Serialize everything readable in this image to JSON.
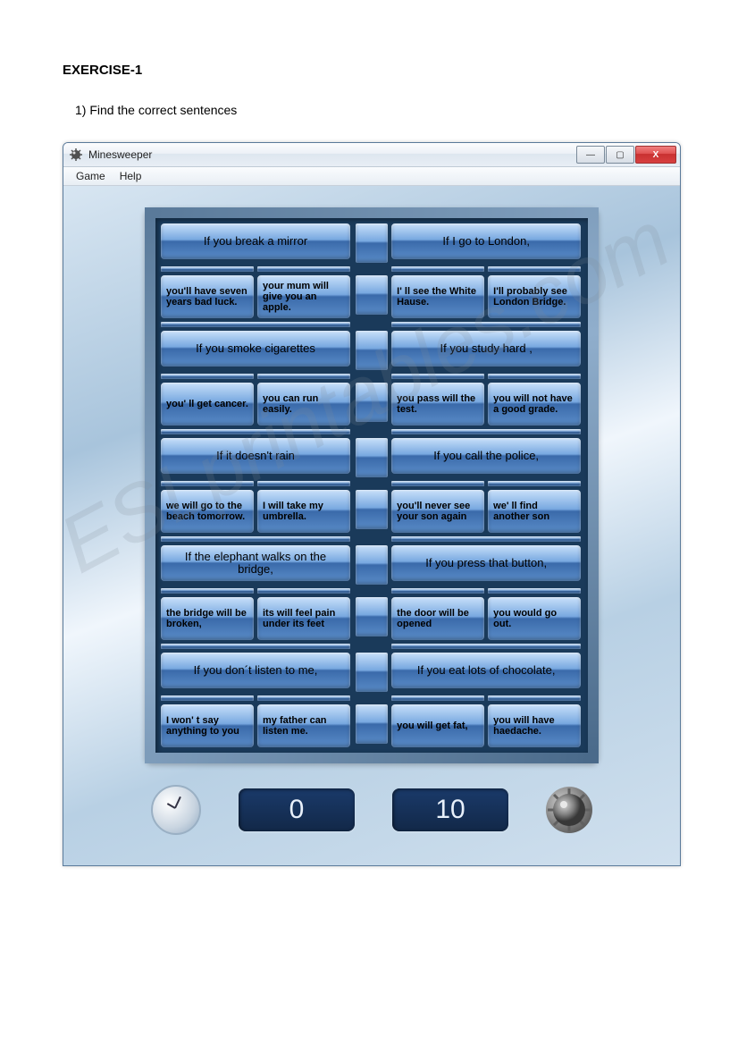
{
  "exercise": {
    "title": "EXERCISE-1",
    "instruction": "1)  Find the correct sentences"
  },
  "window": {
    "title": "Minesweeper",
    "menu": {
      "game": "Game",
      "help": "Help"
    },
    "win_buttons": {
      "min": "—",
      "max": "▢",
      "close": "X"
    }
  },
  "board": {
    "left": [
      {
        "cond": "If you break a mirror",
        "a": "you'll have seven years bad luck.",
        "b": "your mum will give you an apple."
      },
      {
        "cond": "If you smoke cigarettes",
        "a": "you' ll get cancer.",
        "b": "you can run easily."
      },
      {
        "cond": "If it doesn't rain",
        "a": "we will go to the beach tomorrow.",
        "b": "I will take my umbrella."
      },
      {
        "cond": "If the elephant walks on the bridge,",
        "a": "the bridge will be broken,",
        "b": "its will feel pain under its feet"
      },
      {
        "cond": "If you don´t listen to me,",
        "a": "I won' t say anything to you",
        "b": "my father can listen me."
      }
    ],
    "right": [
      {
        "cond": "If I go to London,",
        "a": "I' ll see the White Hause.",
        "b": "I'll probably see London Bridge."
      },
      {
        "cond": "If you study hard ,",
        "a": "you pass will the test.",
        "b": "you will not have a good grade."
      },
      {
        "cond": "If you call the police,",
        "a": "you'll never see your son again",
        "b": "we' ll find another son"
      },
      {
        "cond": "If you press that button,",
        "a": "the door will be opened",
        "b": "you would go out."
      },
      {
        "cond": "If you eat lots of chocolate,",
        "a": "you will get fat,",
        "b": "you will have haedache."
      }
    ]
  },
  "counters": {
    "time": "0",
    "mines": "10"
  },
  "watermark": "ESLprintables.com"
}
